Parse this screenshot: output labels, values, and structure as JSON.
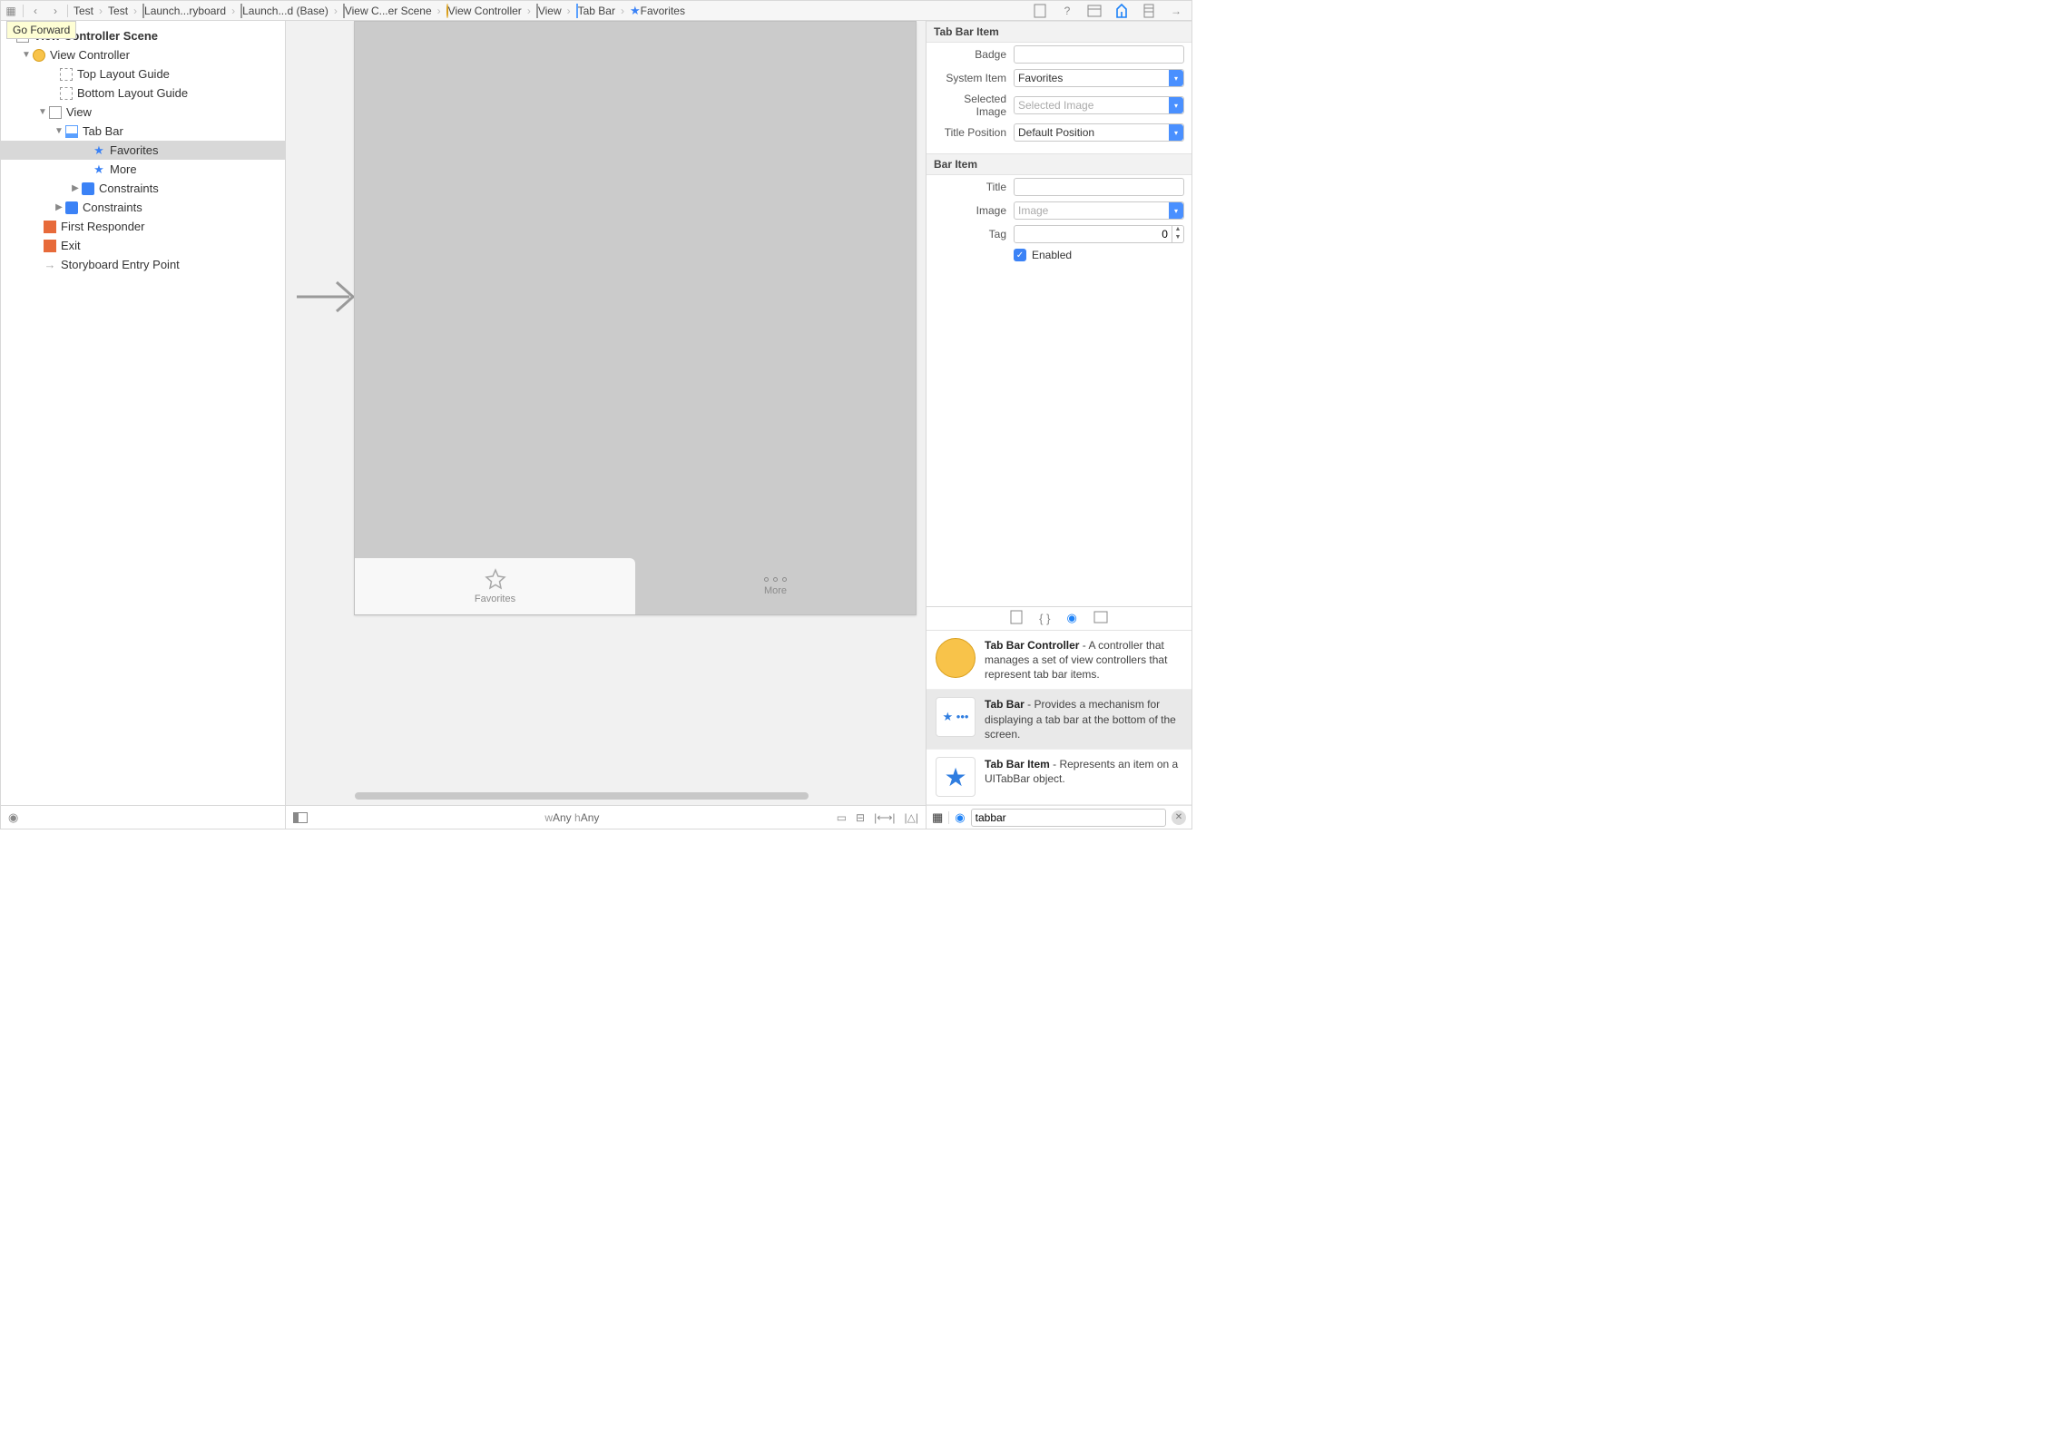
{
  "topbar": {
    "tooltip": "Go Forward",
    "breadcrumb": [
      {
        "label": "Test",
        "icon": "image"
      },
      {
        "label": "Test",
        "icon": "folder"
      },
      {
        "label": "Launch...ryboard",
        "icon": "storyboard"
      },
      {
        "label": "Launch...d (Base)",
        "icon": "storyboard"
      },
      {
        "label": "View C...er Scene",
        "icon": "scene"
      },
      {
        "label": "View Controller",
        "icon": "vc"
      },
      {
        "label": "View",
        "icon": "view"
      },
      {
        "label": "Tab Bar",
        "icon": "tabbar"
      },
      {
        "label": "Favorites",
        "icon": "star"
      }
    ]
  },
  "outline": {
    "scene_title": "View Controller Scene",
    "vc_title": "View Controller",
    "top_guide": "Top Layout Guide",
    "bottom_guide": "Bottom Layout Guide",
    "view": "View",
    "tabbar": "Tab Bar",
    "fav": "Favorites",
    "more": "More",
    "constraints": "Constraints",
    "constraints2": "Constraints",
    "first_responder": "First Responder",
    "exit": "Exit",
    "entry": "Storyboard Entry Point"
  },
  "canvas": {
    "tab_fav": "Favorites",
    "tab_more": "More",
    "size_w": "w",
    "size_any_w": "Any",
    "size_h": " h",
    "size_any_h": "Any"
  },
  "inspector": {
    "sec1": "Tab Bar Item",
    "badge_label": "Badge",
    "badge_value": "",
    "system_item_label": "System Item",
    "system_item_value": "Favorites",
    "selected_image_label": "Selected Image",
    "selected_image_placeholder": "Selected Image",
    "title_position_label": "Title Position",
    "title_position_value": "Default Position",
    "sec2": "Bar Item",
    "title_label": "Title",
    "title_value": "",
    "image_label": "Image",
    "image_placeholder": "Image",
    "tag_label": "Tag",
    "tag_value": "0",
    "enabled_label": "Enabled"
  },
  "library": {
    "items": [
      {
        "title": "Tab Bar Controller",
        "desc": " - A controller that manages a set of view controllers that represent tab bar items."
      },
      {
        "title": "Tab Bar",
        "desc": " - Provides a mechanism for displaying a tab bar at the bottom of the screen."
      },
      {
        "title": "Tab Bar Item",
        "desc": " - Represents an item on a UITabBar object."
      }
    ],
    "search": "tabbar"
  }
}
